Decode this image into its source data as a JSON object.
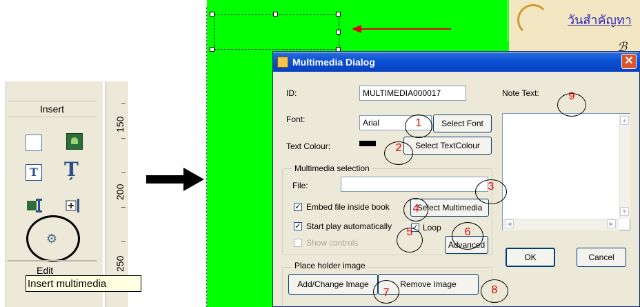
{
  "left_panel": {
    "insert_header": "Insert",
    "edit_header": "Edit",
    "ruler_labels": [
      "150",
      "200",
      "250"
    ],
    "tooltip": "Insert multimedia",
    "icons": [
      "blank-frame-icon",
      "picture-icon",
      "text-box-icon",
      "text-column-icon",
      "picture-column-icon",
      "add-column-icon",
      "multimedia-icon"
    ]
  },
  "page": {
    "thai_heading": "วันสำคัญทา",
    "canvas_color": "#00ff00"
  },
  "dialog": {
    "title": "Multimedia Dialog",
    "close": "✕",
    "id_label": "ID:",
    "id_value": "MULTIMEDIA000017",
    "font_label": "Font:",
    "font_value": "Arial",
    "select_font": "Select Font",
    "text_colour_label": "Text Colour:",
    "select_text_colour": "Select TextColour",
    "note_text_label": "Note Text:",
    "multimedia_group": "Multimedia selection",
    "file_label": "File:",
    "file_value": "",
    "embed_label": "Embed file inside book",
    "embed_checked": true,
    "select_multimedia": "Select Multimedia",
    "autoplay_label": "Start play automatically",
    "autoplay_checked": true,
    "loop_label": "Loop",
    "loop_checked": true,
    "show_controls_label": "Show controls",
    "show_controls_checked": false,
    "advanced": "Advanced",
    "ok": "OK",
    "cancel": "Cancel",
    "placeholder_group": "Place holder image",
    "add_change_image": "Add/Change Image",
    "remove_image": "Remove Image"
  },
  "annotations": [
    "1",
    "2",
    "3",
    "4",
    "5",
    "6",
    "7",
    "8",
    "9"
  ],
  "colors": {
    "annotation_number": "#e00000",
    "titlebar": "#0a50d0",
    "dialog_bg": "#ece9d8",
    "red_arrow": "#e00000"
  }
}
